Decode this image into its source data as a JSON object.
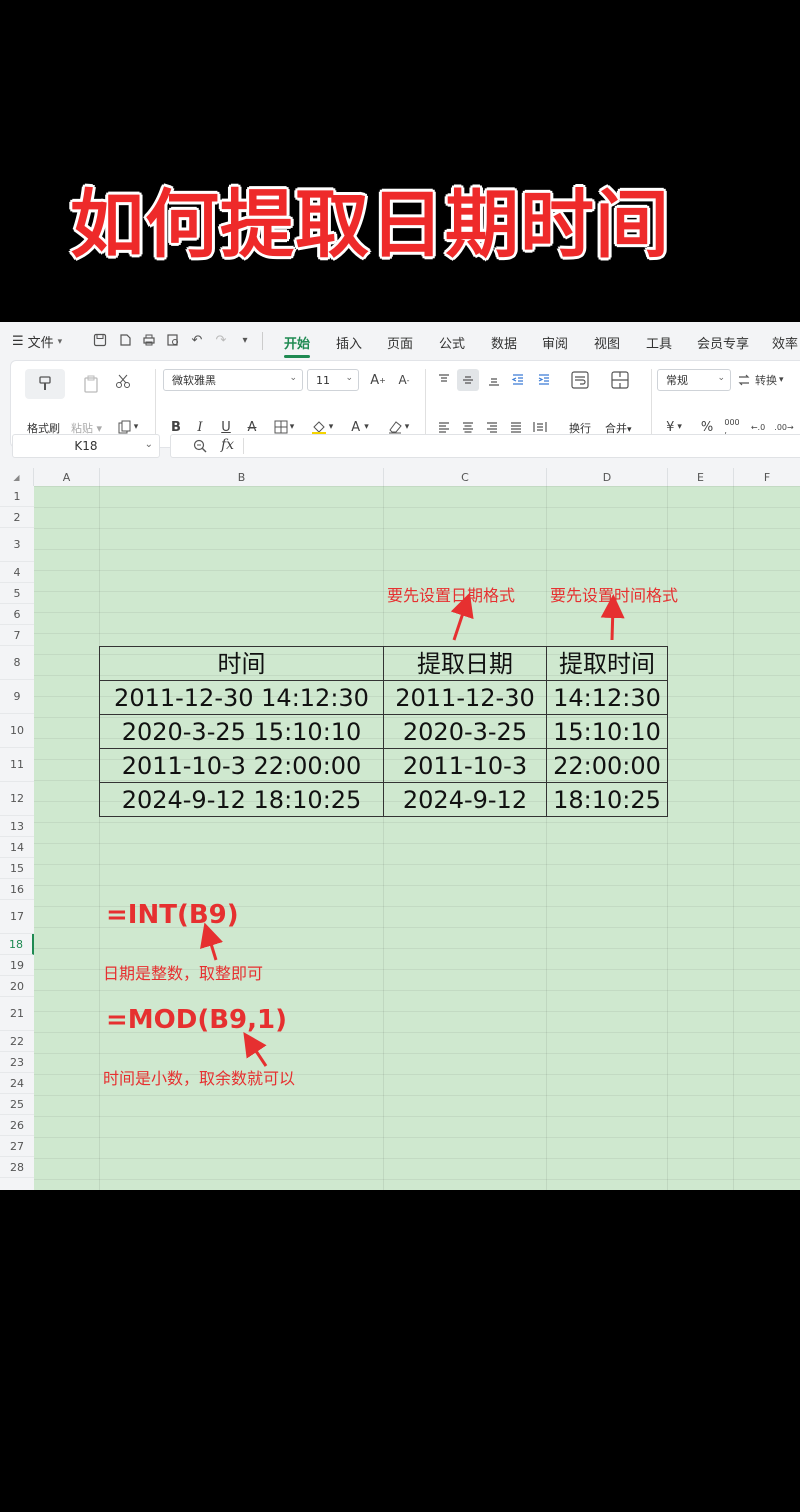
{
  "title": "如何提取日期时间",
  "menubar": {
    "file_label": "文件",
    "tabs": [
      "开始",
      "插入",
      "页面",
      "公式",
      "数据",
      "审阅",
      "视图",
      "工具",
      "会员专享",
      "效率"
    ],
    "active_tab": "开始"
  },
  "ribbon": {
    "format_painter_label": "格式刷",
    "paste_label": "粘贴",
    "font_name": "微软雅黑",
    "font_size": "11",
    "wrap_label": "换行",
    "merge_label": "合并",
    "number_format": "常规",
    "convert_label": "转换"
  },
  "formula_bar": {
    "cell_ref": "K18",
    "fx_label": "fx",
    "content": ""
  },
  "columns": [
    "A",
    "B",
    "C",
    "D",
    "E",
    "F"
  ],
  "rows": [
    "1",
    "2",
    "3",
    "4",
    "5",
    "6",
    "7",
    "8",
    "9",
    "10",
    "11",
    "12",
    "13",
    "14",
    "15",
    "16",
    "17",
    "18",
    "19",
    "20",
    "21",
    "22",
    "23",
    "24",
    "25",
    "26",
    "27",
    "28"
  ],
  "selected_row": "18",
  "table": {
    "headers": [
      "时间",
      "提取日期",
      "提取时间"
    ],
    "rows": [
      [
        "2011-12-30 14:12:30",
        "2011-12-30",
        "14:12:30"
      ],
      [
        "2020-3-25 15:10:10",
        "2020-3-25",
        "15:10:10"
      ],
      [
        "2011-10-3 22:00:00",
        "2011-10-3",
        "22:00:00"
      ],
      [
        "2024-9-12 18:10:25",
        "2024-9-12",
        "18:10:25"
      ]
    ]
  },
  "annotations": {
    "date_format_note": "要先设置日期格式",
    "time_format_note": "要先设置时间格式",
    "int_formula": "=INT(B9)",
    "int_note": "日期是整数，取整即可",
    "mod_formula": "=MOD(B9,1)",
    "mod_note": "时间是小数，取余数就可以"
  },
  "colors": {
    "accent": "#1f8a52",
    "annotation_red": "#e63030",
    "sheet_background": "#cfe8cf",
    "title_red": "#ee2a2a"
  }
}
